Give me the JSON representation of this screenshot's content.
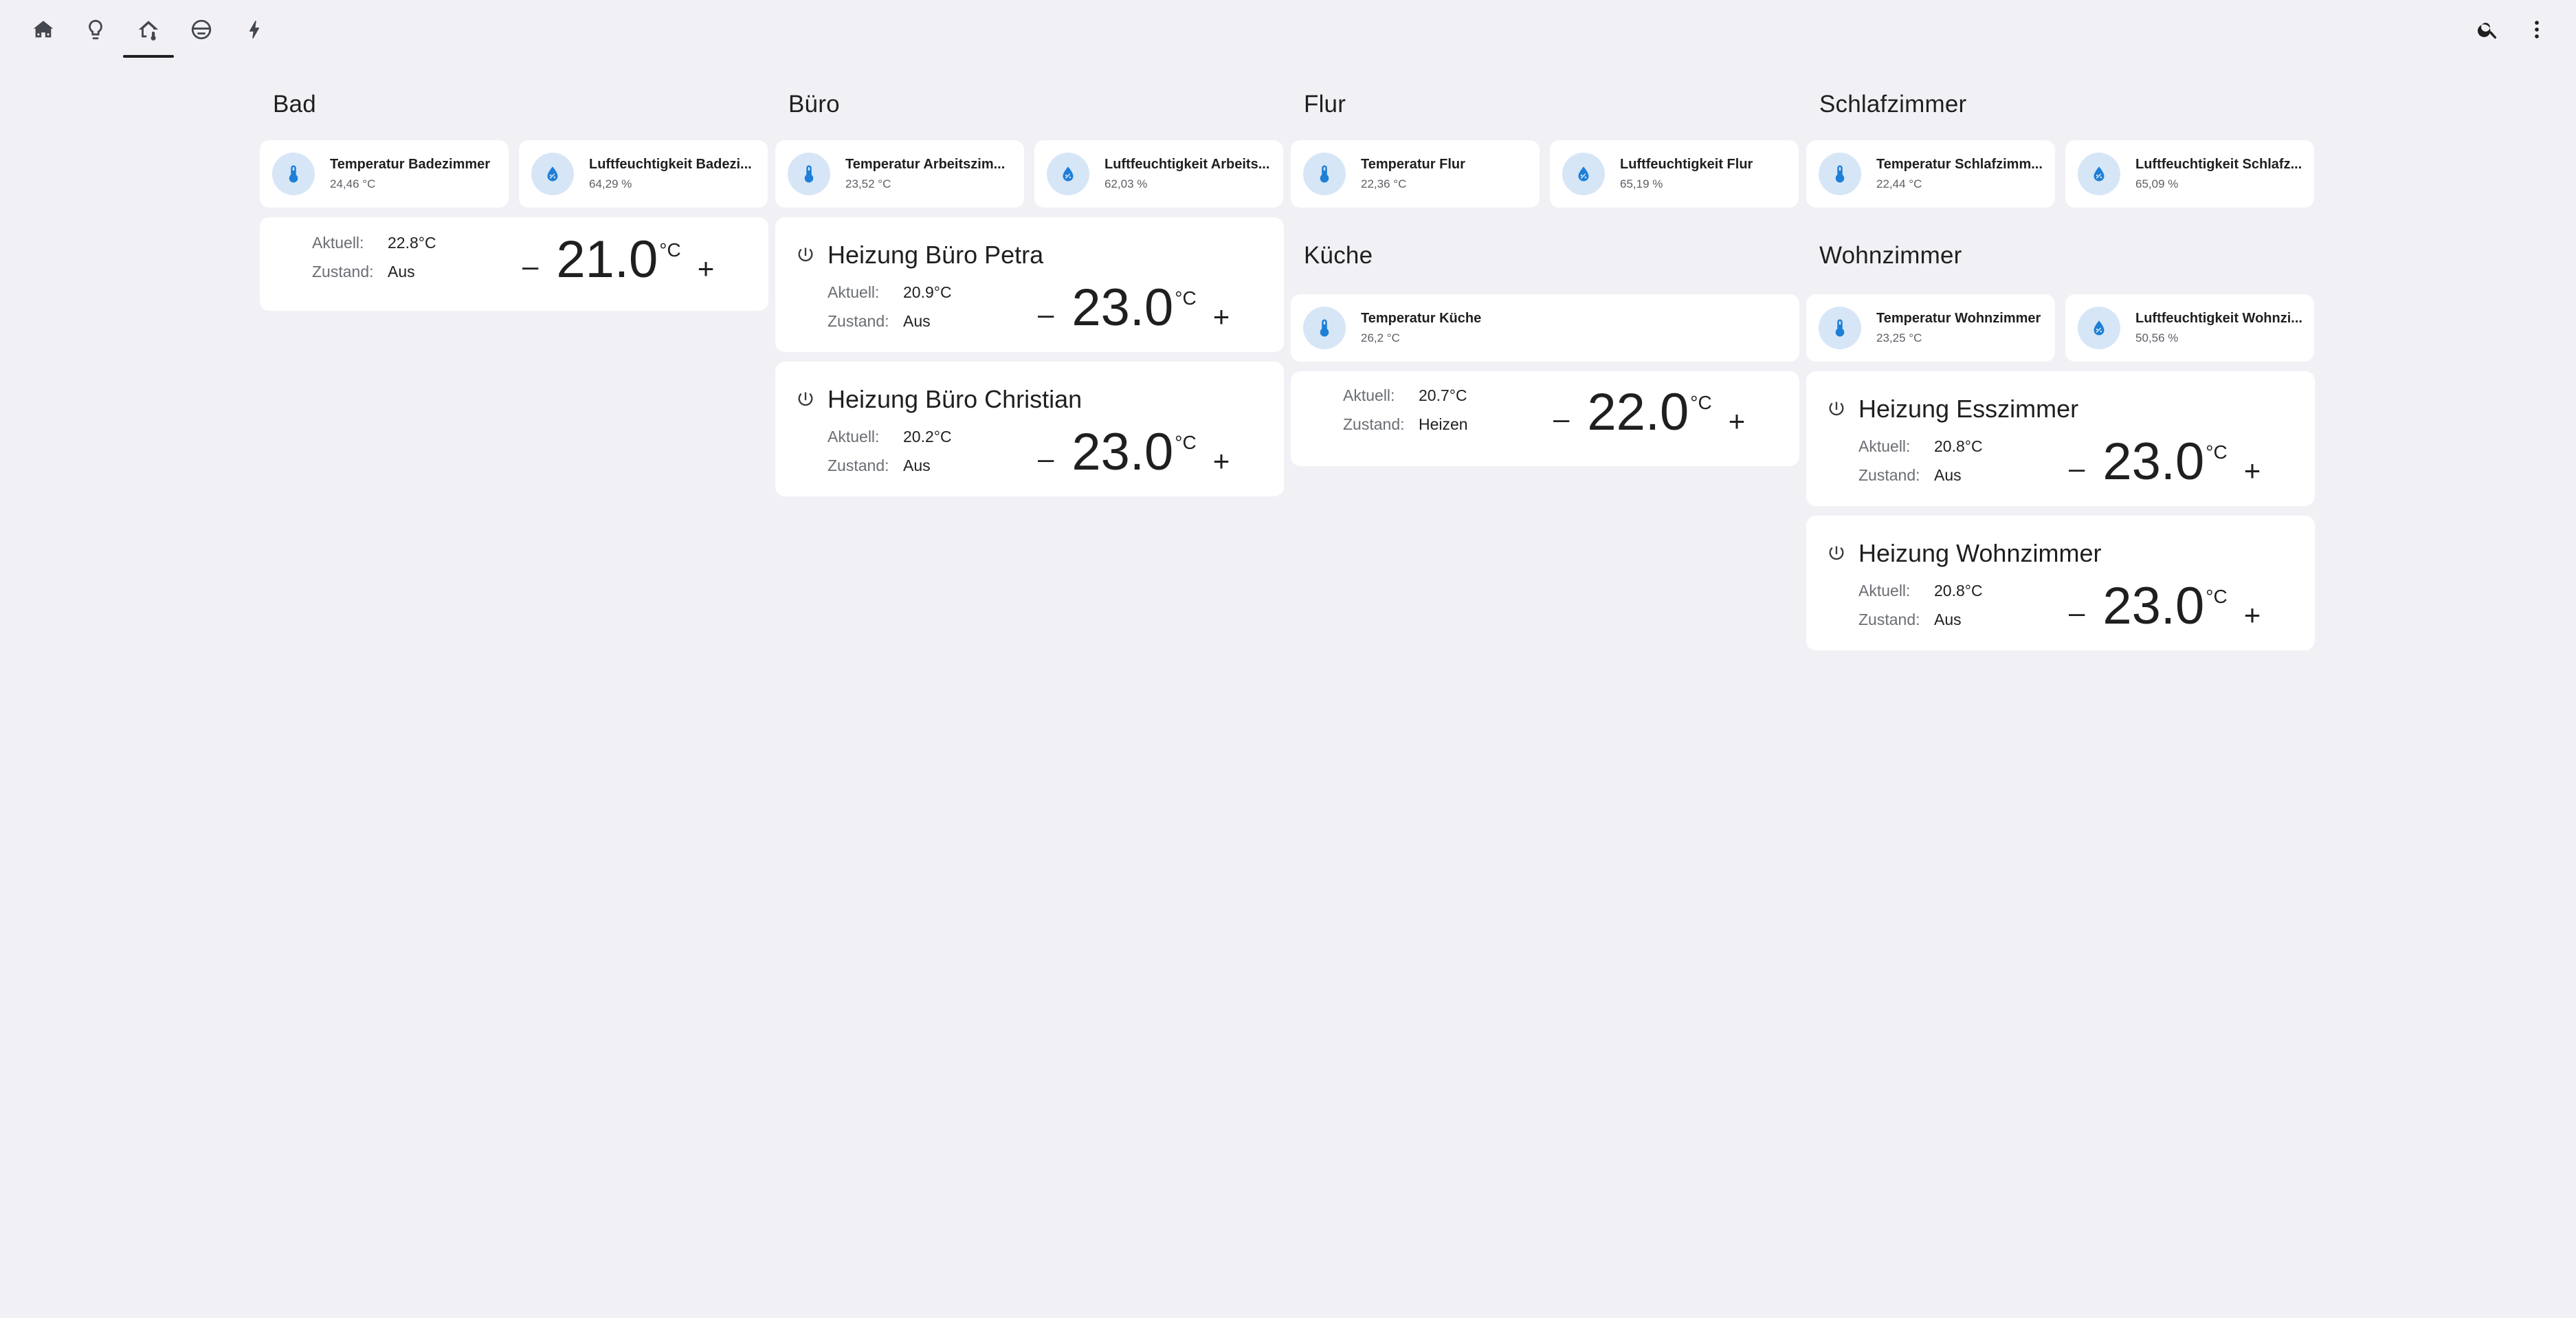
{
  "nav": {
    "tabs": [
      {
        "icon": "home-group-icon"
      },
      {
        "icon": "lightbulb-icon"
      },
      {
        "icon": "home-thermometer-icon",
        "active": true
      },
      {
        "icon": "robot-vacuum-icon"
      },
      {
        "icon": "lightning-bolt-icon"
      }
    ],
    "actions": [
      {
        "icon": "search-icon"
      },
      {
        "icon": "more-vertical-icon"
      }
    ]
  },
  "sections": {
    "bad": {
      "title": "Bad",
      "tiles": [
        {
          "name": "Temperatur Badezimmer",
          "state": "24,46 °C",
          "icon": "thermometer-icon"
        },
        {
          "name": "Luftfeuchtigkeit Badezi...",
          "state": "64,29 %",
          "icon": "water-percent-icon"
        }
      ],
      "thermostats": [
        {
          "title": "",
          "current_label": "Aktuell:",
          "current": "22.8°C",
          "state_label": "Zustand:",
          "state": "Aus",
          "target": "21.0",
          "unit": "°C",
          "minus": "–",
          "plus": "+"
        }
      ]
    },
    "buero": {
      "title": "Büro",
      "tiles": [
        {
          "name": "Temperatur Arbeitszim...",
          "state": "23,52 °C",
          "icon": "thermometer-icon"
        },
        {
          "name": "Luftfeuchtigkeit Arbeits...",
          "state": "62,03 %",
          "icon": "water-percent-icon"
        }
      ],
      "thermostats": [
        {
          "title": "Heizung Büro Petra",
          "current_label": "Aktuell:",
          "current": "20.9°C",
          "state_label": "Zustand:",
          "state": "Aus",
          "target": "23.0",
          "unit": "°C",
          "minus": "–",
          "plus": "+"
        },
        {
          "title": "Heizung Büro Christian",
          "current_label": "Aktuell:",
          "current": "20.2°C",
          "state_label": "Zustand:",
          "state": "Aus",
          "target": "23.0",
          "unit": "°C",
          "minus": "–",
          "plus": "+"
        }
      ]
    },
    "flur": {
      "title": "Flur",
      "tiles": [
        {
          "name": "Temperatur Flur",
          "state": "22,36 °C",
          "icon": "thermometer-icon"
        },
        {
          "name": "Luftfeuchtigkeit Flur",
          "state": "65,19 %",
          "icon": "water-percent-icon"
        }
      ]
    },
    "kueche": {
      "title": "Küche",
      "tiles": [
        {
          "name": "Temperatur Küche",
          "state": "26,2 °C",
          "icon": "thermometer-icon"
        }
      ],
      "thermostats": [
        {
          "title": "",
          "current_label": "Aktuell:",
          "current": "20.7°C",
          "state_label": "Zustand:",
          "state": "Heizen",
          "target": "22.0",
          "unit": "°C",
          "minus": "–",
          "plus": "+"
        }
      ]
    },
    "schlafzimmer": {
      "title": "Schlafzimmer",
      "tiles": [
        {
          "name": "Temperatur Schlafzimm...",
          "state": "22,44 °C",
          "icon": "thermometer-icon"
        },
        {
          "name": "Luftfeuchtigkeit Schlafz...",
          "state": "65,09 %",
          "icon": "water-percent-icon"
        }
      ]
    },
    "wohnzimmer": {
      "title": "Wohnzimmer",
      "tiles": [
        {
          "name": "Temperatur Wohnzimmer",
          "state": "23,25 °C",
          "icon": "thermometer-icon"
        },
        {
          "name": "Luftfeuchtigkeit Wohnzi...",
          "state": "50,56 %",
          "icon": "water-percent-icon"
        }
      ],
      "thermostats": [
        {
          "title": "Heizung Esszimmer",
          "current_label": "Aktuell:",
          "current": "20.8°C",
          "state_label": "Zustand:",
          "state": "Aus",
          "target": "23.0",
          "unit": "°C",
          "minus": "–",
          "plus": "+"
        },
        {
          "title": "Heizung Wohnzimmer",
          "current_label": "Aktuell:",
          "current": "20.8°C",
          "state_label": "Zustand:",
          "state": "Aus",
          "target": "23.0",
          "unit": "°C",
          "minus": "–",
          "plus": "+"
        }
      ]
    }
  },
  "colors": {
    "background": "#f1f1f5",
    "card": "#ffffff",
    "icon_accent": "#1e7fd7",
    "icon_bubble": "#d6e6f7"
  }
}
